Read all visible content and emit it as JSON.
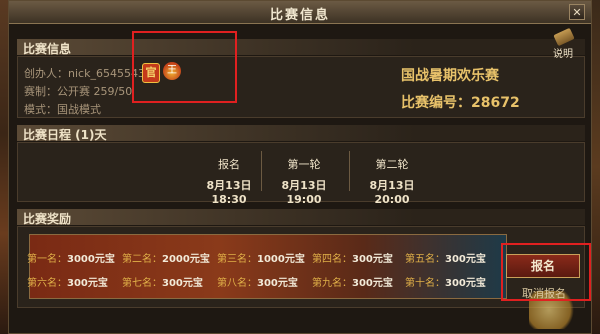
{
  "window": {
    "title": "比赛信息",
    "close_label": "✕"
  },
  "info_section": {
    "header": "比赛信息",
    "creator": "创办人：nick_654554348",
    "type": "赛制：公开赛  259/50",
    "mode": "模式：国战模式",
    "badge_guan": "官",
    "badge_second": "王",
    "match_title": "国战暑期欢乐赛",
    "match_number": "比赛编号：28672",
    "help_label": "说明"
  },
  "schedule": {
    "header": "比赛日程 (1)天",
    "columns": [
      {
        "label": "报名",
        "time": "8月13日 18:30"
      },
      {
        "label": "第一轮",
        "time": "8月13日 19:00"
      },
      {
        "label": "第二轮",
        "time": "8月13日 20:00"
      }
    ]
  },
  "rewards": {
    "header": "比赛奖励",
    "items": [
      {
        "rank": "第一名：",
        "value": "3000元宝"
      },
      {
        "rank": "第二名：",
        "value": "2000元宝"
      },
      {
        "rank": "第三名：",
        "value": "1000元宝"
      },
      {
        "rank": "第四名：",
        "value": "300元宝"
      },
      {
        "rank": "第五名：",
        "value": "300元宝"
      },
      {
        "rank": "第六名：",
        "value": "300元宝"
      },
      {
        "rank": "第七名：",
        "value": "300元宝"
      },
      {
        "rank": "第八名：",
        "value": "300元宝"
      },
      {
        "rank": "第九名：",
        "value": "300元宝"
      },
      {
        "rank": "第十名：",
        "value": "300元宝"
      }
    ]
  },
  "actions": {
    "signup": "报名",
    "cancel": "取消报名"
  },
  "colors": {
    "accent_gold": "#e8c26a",
    "highlight_red": "#e02020"
  }
}
